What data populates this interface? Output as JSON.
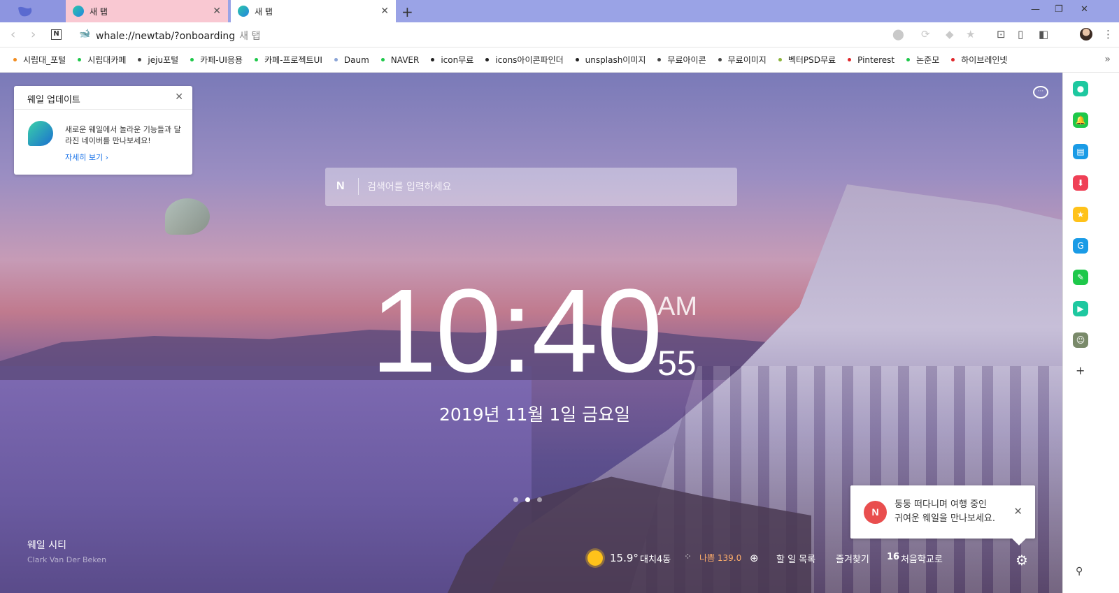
{
  "tabs": [
    {
      "label": "새 탭"
    },
    {
      "label": "새 탭"
    }
  ],
  "address": {
    "url": "whale://newtab/?onboarding",
    "page_title": "새 탭"
  },
  "bookmarks": [
    {
      "label": "시립대_포털",
      "color": "#f28c1f"
    },
    {
      "label": "시립대카페",
      "color": "#1ec84a"
    },
    {
      "label": "jeju포털",
      "color": "#444444"
    },
    {
      "label": "카페-UI응용",
      "color": "#1ec84a"
    },
    {
      "label": "카페-프로젝트UI",
      "color": "#1ec84a"
    },
    {
      "label": "Daum",
      "color": "#8aa4d6"
    },
    {
      "label": "NAVER",
      "color": "#1ec84a"
    },
    {
      "label": "icon무료",
      "color": "#222222"
    },
    {
      "label": "icons아이콘파인더",
      "color": "#222222"
    },
    {
      "label": "unsplash이미지",
      "color": "#222222"
    },
    {
      "label": "무료아이콘",
      "color": "#444444"
    },
    {
      "label": "무료이미지",
      "color": "#444444"
    },
    {
      "label": "벡터PSD무료",
      "color": "#8cb43c"
    },
    {
      "label": "Pinterest",
      "color": "#e0262a"
    },
    {
      "label": "논준모",
      "color": "#1ec84a"
    },
    {
      "label": "하이브레인넷",
      "color": "#e0262a"
    }
  ],
  "update_card": {
    "title": "웨일 업데이트",
    "message": "새로운 웨일에서 놀라운 기능들과 달라진 네이버를 만나보세요!",
    "link": "자세히 보기 ›"
  },
  "search": {
    "placeholder": "검색어를 입력하세요"
  },
  "clock": {
    "time": "10:40",
    "ampm": "AM",
    "seconds": "55",
    "date": "2019년 11월 1일 금요일"
  },
  "carousel": {
    "count": 3,
    "active": 1
  },
  "credit": {
    "title": "웨일 시티",
    "author": "Clark Van Der Beken"
  },
  "notification": {
    "badge": "N",
    "line1": "둥둥 떠다니며 여행 중인",
    "line2": "귀여운 웨일을 만나보세요."
  },
  "status_bar": {
    "temperature": "15.9°",
    "location": "대치4동",
    "air_quality": "나쁨 139.0",
    "todo": "할 일 목록",
    "favorites": "즐겨찾기",
    "date_num": "16",
    "school": "처음학교로"
  },
  "sidebar_icons": [
    {
      "name": "green-circle-icon",
      "color": "#1ec8a0"
    },
    {
      "name": "bell-icon",
      "color": "#1ec84a"
    },
    {
      "name": "calendar-icon",
      "color": "#1a9be6"
    },
    {
      "name": "pocket-icon",
      "color": "#ef4056"
    },
    {
      "name": "star-icon",
      "color": "#ffc21a"
    },
    {
      "name": "translate-icon",
      "color": "#1a9be6"
    },
    {
      "name": "memo-icon",
      "color": "#1ec84a"
    },
    {
      "name": "play-icon",
      "color": "#1ec8a0"
    },
    {
      "name": "avatar-icon",
      "color": "#7a8a6a"
    }
  ],
  "colors": {
    "tabstrip": "#9aa3e6",
    "active_tab": "#ffffff",
    "inactive_tab": "#f9c8d2",
    "air_quality_warn": "#ffae6b"
  }
}
